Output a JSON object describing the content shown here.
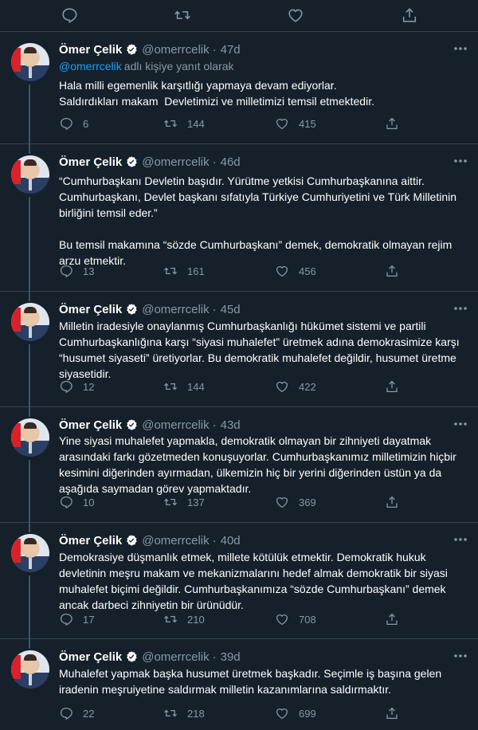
{
  "colors": {
    "background": "#15202b",
    "border": "#38444d",
    "muted": "#8899a6",
    "accent": "#1da1f2",
    "text": "#ffffff"
  },
  "icons": {
    "reply": "reply-icon",
    "retweet": "retweet-icon",
    "like": "heart-icon",
    "share": "share-icon",
    "verified": "verified-badge-icon",
    "more": "more-options-icon"
  },
  "author": {
    "name": "Ömer Çelik",
    "handle": "@omerrcelik",
    "dot": "·"
  },
  "tweets": [
    {
      "time": "47d",
      "reply_to": {
        "handle": "@omerrcelik",
        "rest": "adlı kişiye yanıt olarak"
      },
      "text": "Hala milli egemenlik karşıtlığı yapmaya devam ediyorlar.\nSaldırdıkları makam  Devletimizi ve milletimizi temsil etmektedir.",
      "replies": "6",
      "retweets": "144",
      "likes": "415"
    },
    {
      "time": "46d",
      "text": "“Cumhurbaşkanı Devletin başıdır. Yürütme yetkisi Cumhurbaşkanına aittir. Cumhurbaşkanı, Devlet başkanı sıfatıyla Türkiye Cumhuriyetini ve Türk Milletinin birliğini temsil eder.”\n\nBu temsil makamına “sözde Cumhurbaşkanı” demek, demokratik olmayan rejim arzu etmektir.",
      "replies": "13",
      "retweets": "161",
      "likes": "456"
    },
    {
      "time": "45d",
      "text": "Milletin iradesiyle onaylanmış Cumhurbaşkanlığı hükümet sistemi ve partili Cumhurbaşkanlığına karşı “siyasi muhalefet” üretmek adına demokrasimize karşı “husumet siyaseti” üretiyorlar. Bu demokratik muhalefet değildir, husumet üretme siyasetidir.",
      "replies": "12",
      "retweets": "144",
      "likes": "422"
    },
    {
      "time": "43d",
      "text": "Yine siyasi muhalefet yapmakla, demokratik olmayan bir zihniyeti dayatmak arasındaki farkı gözetmeden konuşuyorlar. Cumhurbaşkanımız milletimizin hiçbir kesimini diğerinden ayırmadan, ülkemizin hiç bir yerini diğerinden üstün ya da aşağıda saymadan görev yapmaktadır.",
      "replies": "10",
      "retweets": "137",
      "likes": "369"
    },
    {
      "time": "40d",
      "text": "Demokrasiye düşmanlık etmek, millete kötülük etmektir. Demokratik hukuk devletinin meşru makam ve mekanizmalarını hedef almak demokratik bir siyasi muhalefet biçimi değildir. Cumhurbaşkanımıza “sözde Cumhurbaşkanı” demek ancak darbeci zihniyetin bir ürünüdür.",
      "replies": "17",
      "retweets": "210",
      "likes": "708"
    },
    {
      "time": "39d",
      "text": "Muhalefet yapmak başka husumet üretmek başkadır. Seçimle iş başına gelen iradenin meşruiyetine saldırmak milletin kazanımlarına saldırmaktır.",
      "replies": "22",
      "retweets": "218",
      "likes": "699"
    }
  ]
}
